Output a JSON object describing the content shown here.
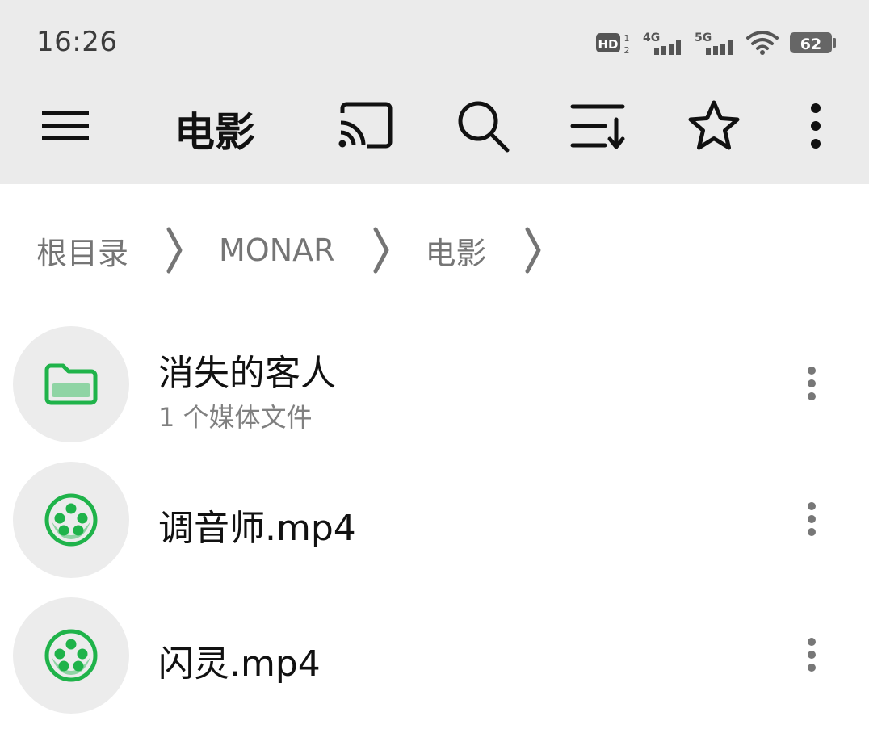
{
  "status_bar": {
    "time": "16:26",
    "hd_label": "HD",
    "hd_sub": "1\n2",
    "net1": "4G",
    "net2": "5G",
    "battery": "62",
    "icons": [
      "hd-icon",
      "signal-4g-icon",
      "signal-5g-icon",
      "wifi-icon",
      "battery-icon"
    ]
  },
  "toolbar": {
    "title": "电影",
    "icons": [
      "menu-icon",
      "cast-icon",
      "search-icon",
      "sort-icon",
      "star-icon",
      "more-vert-icon"
    ]
  },
  "breadcrumb": {
    "items": [
      "根目录",
      "MONAR",
      "电影"
    ],
    "separator_icon": "chevron-right-icon"
  },
  "files": [
    {
      "name": "消失的客人",
      "subtitle": "1 个媒体文件",
      "type": "folder",
      "icon": "folder-icon"
    },
    {
      "name": "调音师.mp4",
      "subtitle": "",
      "type": "video",
      "icon": "film-reel-icon"
    },
    {
      "name": "闪灵.mp4",
      "subtitle": "",
      "type": "video",
      "icon": "film-reel-icon"
    }
  ],
  "colors": {
    "topbar_bg": "#ebebeb",
    "accent_green": "#1fb34a",
    "avatar_bg": "#ececec",
    "muted_text": "#757575"
  }
}
